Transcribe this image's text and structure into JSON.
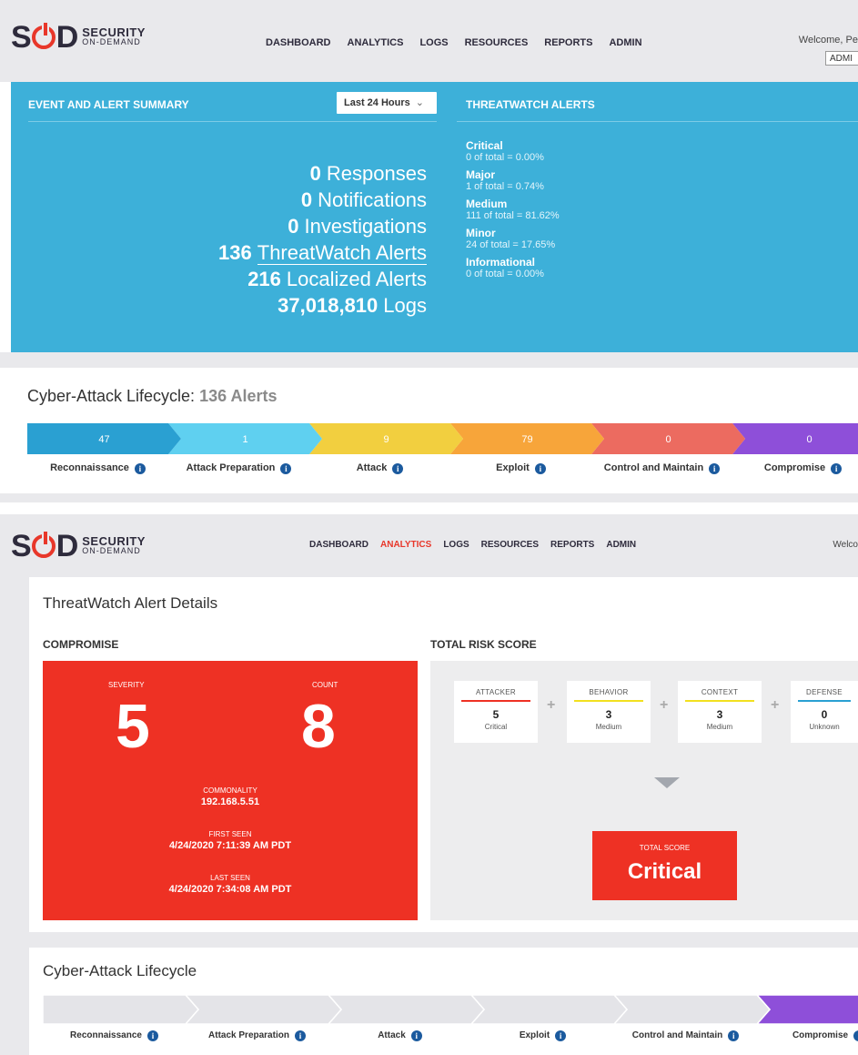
{
  "logo": {
    "main": "SUD",
    "line1": "SECURITY",
    "line2": "ON-DEMAND"
  },
  "nav": [
    "DASHBOARD",
    "ANALYTICS",
    "LOGS",
    "RESOURCES",
    "REPORTS",
    "ADMIN"
  ],
  "panel1": {
    "welcome": "Welcome, Pe",
    "role_select": "ADMI",
    "summary": {
      "title": "EVENT AND ALERT SUMMARY",
      "time_range": "Last 24 Hours",
      "stats": [
        {
          "value": "0",
          "label": "Responses"
        },
        {
          "value": "0",
          "label": "Notifications"
        },
        {
          "value": "0",
          "label": "Investigations"
        },
        {
          "value": "136",
          "label": "ThreatWatch Alerts"
        },
        {
          "value": "216",
          "label": "Localized Alerts"
        },
        {
          "value": "37,018,810",
          "label": "Logs"
        }
      ]
    },
    "threatwatch": {
      "title": "THREATWATCH ALERTS",
      "levels": [
        {
          "name": "Critical",
          "detail": "0 of total = 0.00%"
        },
        {
          "name": "Major",
          "detail": "1 of total = 0.74%"
        },
        {
          "name": "Medium",
          "detail": "111 of total = 81.62%"
        },
        {
          "name": "Minor",
          "detail": "24 of total = 17.65%"
        },
        {
          "name": "Informational",
          "detail": "0 of total = 0.00%"
        }
      ]
    },
    "lifecycle": {
      "title": "Cyber-Attack Lifecycle:",
      "count": "136 Alerts",
      "stages": [
        {
          "label": "Reconnaissance",
          "value": "47",
          "color": "#2aa0d2"
        },
        {
          "label": "Attack Preparation",
          "value": "1",
          "color": "#5fd0f0"
        },
        {
          "label": "Attack",
          "value": "9",
          "color": "#f2cf3f"
        },
        {
          "label": "Exploit",
          "value": "79",
          "color": "#f7a53a"
        },
        {
          "label": "Control and Maintain",
          "value": "0",
          "color": "#ec6b60"
        },
        {
          "label": "Compromise",
          "value": "0",
          "color": "#8e4fd9"
        }
      ]
    }
  },
  "panel2": {
    "welcome": "Welco",
    "active_nav": "ANALYTICS",
    "details": {
      "title": "ThreatWatch Alert Details",
      "compromise": {
        "heading": "COMPROMISE",
        "severity_label": "SEVERITY",
        "severity": "5",
        "count_label": "COUNT",
        "count": "8",
        "commonality_label": "COMMONALITY",
        "commonality": "192.168.5.51",
        "first_seen_label": "FIRST SEEN",
        "first_seen": "4/24/2020 7:11:39 AM PDT",
        "last_seen_label": "LAST SEEN",
        "last_seen": "4/24/2020 7:34:08 AM PDT"
      },
      "risk": {
        "heading": "TOTAL RISK SCORE",
        "factors": [
          {
            "title": "ATTACKER",
            "value": "5",
            "level": "Critical",
            "color": "#ee3124"
          },
          {
            "title": "BEHAVIOR",
            "value": "3",
            "level": "Medium",
            "color": "#f2e01f"
          },
          {
            "title": "CONTEXT",
            "value": "3",
            "level": "Medium",
            "color": "#f2e01f"
          },
          {
            "title": "DEFENSE",
            "value": "0",
            "level": "Unknown",
            "color": "#2aa0d2"
          }
        ],
        "total_label": "TOTAL SCORE",
        "total": "Critical"
      }
    },
    "lifecycle": {
      "title": "Cyber-Attack Lifecycle",
      "stages": [
        "Reconnaissance",
        "Attack Preparation",
        "Attack",
        "Exploit",
        "Control and Maintain",
        "Compromise"
      ],
      "active_stage": "Compromise",
      "inactive_color": "#e4e4e8",
      "active_color": "#8e4fd9"
    }
  }
}
